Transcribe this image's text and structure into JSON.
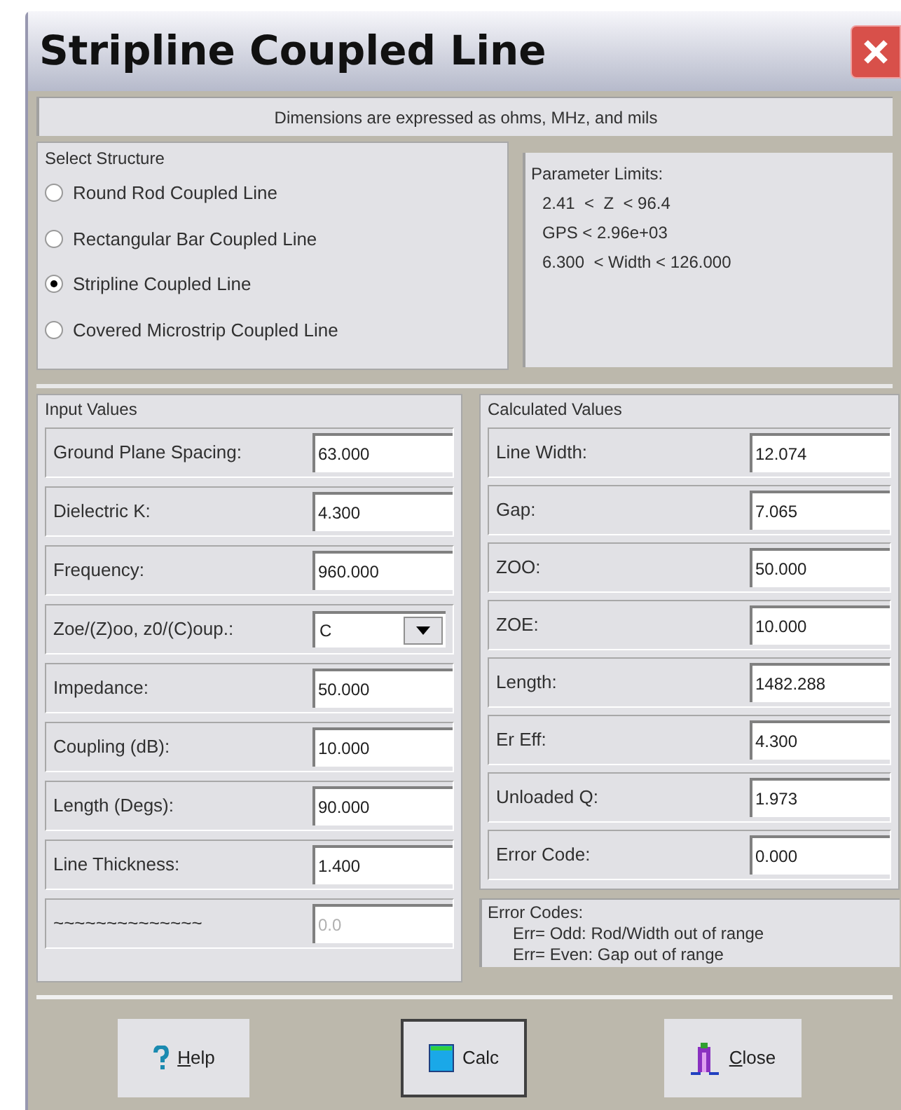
{
  "window": {
    "title": "Stripline Coupled Line"
  },
  "info_bar": "Dimensions are expressed as ohms, MHz, and mils",
  "select_structure": {
    "title": "Select Structure",
    "options": [
      {
        "label": "Round Rod Coupled Line",
        "selected": false
      },
      {
        "label": "Rectangular Bar Coupled Line",
        "selected": false
      },
      {
        "label": "Stripline Coupled Line",
        "selected": true
      },
      {
        "label": "Covered Microstrip Coupled Line",
        "selected": false
      }
    ]
  },
  "parameter_limits": {
    "title": "Parameter Limits:",
    "lines": [
      "2.41  <  Z  < 96.4",
      "GPS < 2.96e+03",
      "6.300  < Width < 126.000"
    ]
  },
  "input_values": {
    "title": "Input Values",
    "rows": [
      {
        "kind": "text",
        "label": "Ground Plane Spacing:",
        "value": "63.000",
        "disabled": false
      },
      {
        "kind": "text",
        "label": "Dielectric K:",
        "value": "4.300",
        "disabled": false
      },
      {
        "kind": "text",
        "label": "Frequency:",
        "value": "960.000",
        "disabled": false
      },
      {
        "kind": "select",
        "label": "Zoe/(Z)oo, z0/(C)oup.:",
        "value": "C",
        "disabled": false
      },
      {
        "kind": "text",
        "label": "Impedance:",
        "value": "50.000",
        "disabled": false
      },
      {
        "kind": "text",
        "label": "Coupling (dB):",
        "value": "10.000",
        "disabled": false
      },
      {
        "kind": "text",
        "label": "Length (Degs):",
        "value": "90.000",
        "disabled": false
      },
      {
        "kind": "text",
        "label": "Line Thickness:",
        "value": "1.400",
        "disabled": false
      },
      {
        "kind": "text",
        "label": "~~~~~~~~~~~~~~",
        "value": "0.0",
        "disabled": true
      }
    ]
  },
  "calculated_values": {
    "title": "Calculated Values",
    "rows": [
      {
        "label": "Line Width:",
        "value": "12.074"
      },
      {
        "label": "Gap:",
        "value": "7.065"
      },
      {
        "label": "ZOO:",
        "value": "50.000"
      },
      {
        "label": "ZOE:",
        "value": "10.000"
      },
      {
        "label": "Length:",
        "value": "1482.288"
      },
      {
        "label": "Er Eff:",
        "value": "4.300"
      },
      {
        "label": "Unloaded Q:",
        "value": "1.973"
      },
      {
        "label": "Error Code:",
        "value": "0.000"
      }
    ]
  },
  "error_codes": {
    "title": "Error Codes:",
    "lines": [
      "Err= Odd: Rod/Width out of range",
      "Err= Even: Gap out of range"
    ]
  },
  "buttons": [
    {
      "kind": "help",
      "label": "Help"
    },
    {
      "kind": "calc",
      "label": "Calc"
    },
    {
      "kind": "close",
      "label": "Close"
    }
  ]
}
